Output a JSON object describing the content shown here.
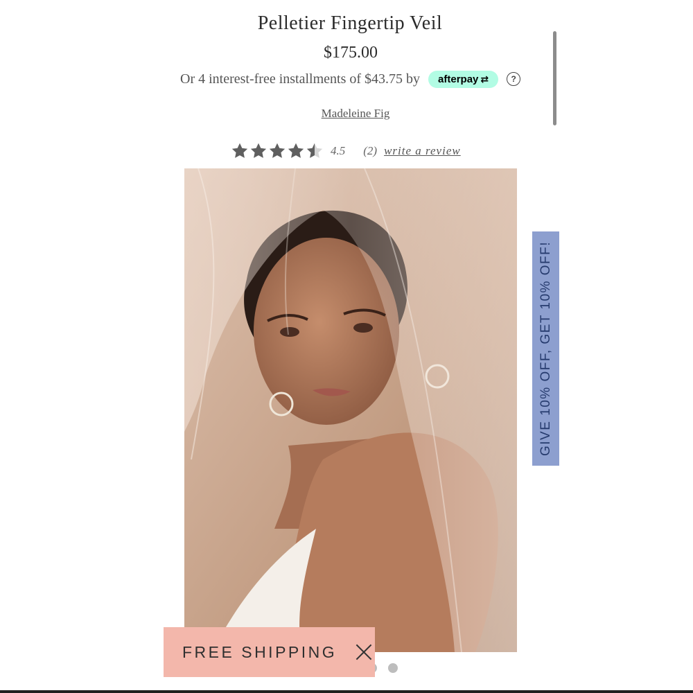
{
  "product": {
    "title": "Pelletier Fingertip Veil",
    "price": "$175.00",
    "installments_text": "Or 4 interest-free installments of $43.75 by",
    "afterpay_label": "afterpay",
    "help_icon": "question-circle-icon",
    "designer": "Madeleine Fig"
  },
  "rating": {
    "stars": 4.5,
    "value": "4.5",
    "count": "(2)",
    "write_review": "write a review",
    "star_color": "#5f5f5f"
  },
  "promo_tab": {
    "text": "GIVE 10% OFF, GET 10% OFF!",
    "background": "#8d9fcf"
  },
  "shipping_banner": {
    "text": "FREE SHIPPING",
    "close_icon": "close-icon",
    "background": "#f3b7ab"
  },
  "carousel": {
    "dot_count": 2
  }
}
